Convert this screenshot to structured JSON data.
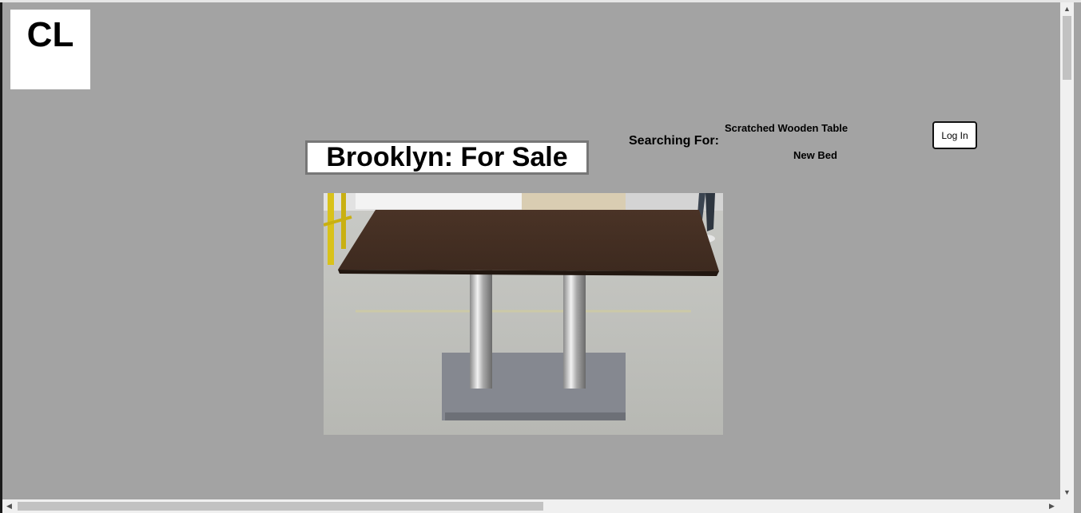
{
  "logo": {
    "text": "CL"
  },
  "page_title": "Brooklyn: For Sale",
  "search": {
    "label": "Searching For:",
    "items": [
      "Scratched Wooden Table",
      "New Bed"
    ]
  },
  "auth": {
    "login_label": "Log In"
  },
  "listing_image": {
    "icon": "table-photo"
  },
  "scrollbars": {
    "up_arrow": "▲",
    "down_arrow": "▼",
    "left_arrow": "◀",
    "right_arrow": "▶"
  },
  "colors": {
    "page_bg": "#a3a3a3",
    "title_border": "#777777",
    "button_border": "#111111"
  }
}
